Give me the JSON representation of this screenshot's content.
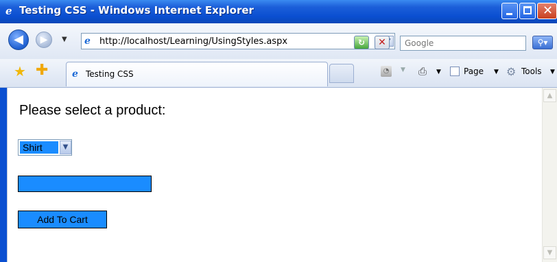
{
  "window": {
    "title": "Testing CSS - Windows Internet Explorer",
    "title_icon": "ie-logo-icon",
    "controls": {
      "minimize": "minimize-icon",
      "maximize": "maximize-icon",
      "close": "close-icon",
      "close_glyph": "✕"
    }
  },
  "navigation": {
    "back_glyph": "◀",
    "forward_glyph": "▶",
    "history_glyph": "▼",
    "address": "http://localhost/Learning/UsingStyles.aspx",
    "address_dropdown_glyph": "▼",
    "refresh_glyph": "↻",
    "stop_glyph": "✕",
    "search_placeholder": "Google",
    "search_button_glyph": "⚲▾"
  },
  "tabs": {
    "active_tab": "Testing CSS",
    "favorites_glyph": "★",
    "add_favorite_glyph": "✚"
  },
  "command_bar": {
    "feeds_glyph": "◔",
    "print_glyph": "⎙",
    "page_label": "Page",
    "tools_label": "Tools",
    "tools_glyph": "⚙",
    "dropdown_glyph": "▼"
  },
  "page": {
    "heading": "Please select a product:",
    "product_select": {
      "selected": "Shirt",
      "arrow_glyph": "▼"
    },
    "quantity_value": "",
    "add_to_cart_label": "Add To Cart"
  },
  "scrollbar": {
    "up_glyph": "▲",
    "down_glyph": "▼"
  },
  "colors": {
    "titlebar": "#0a4fd1",
    "control_accent": "#1a8cff"
  }
}
